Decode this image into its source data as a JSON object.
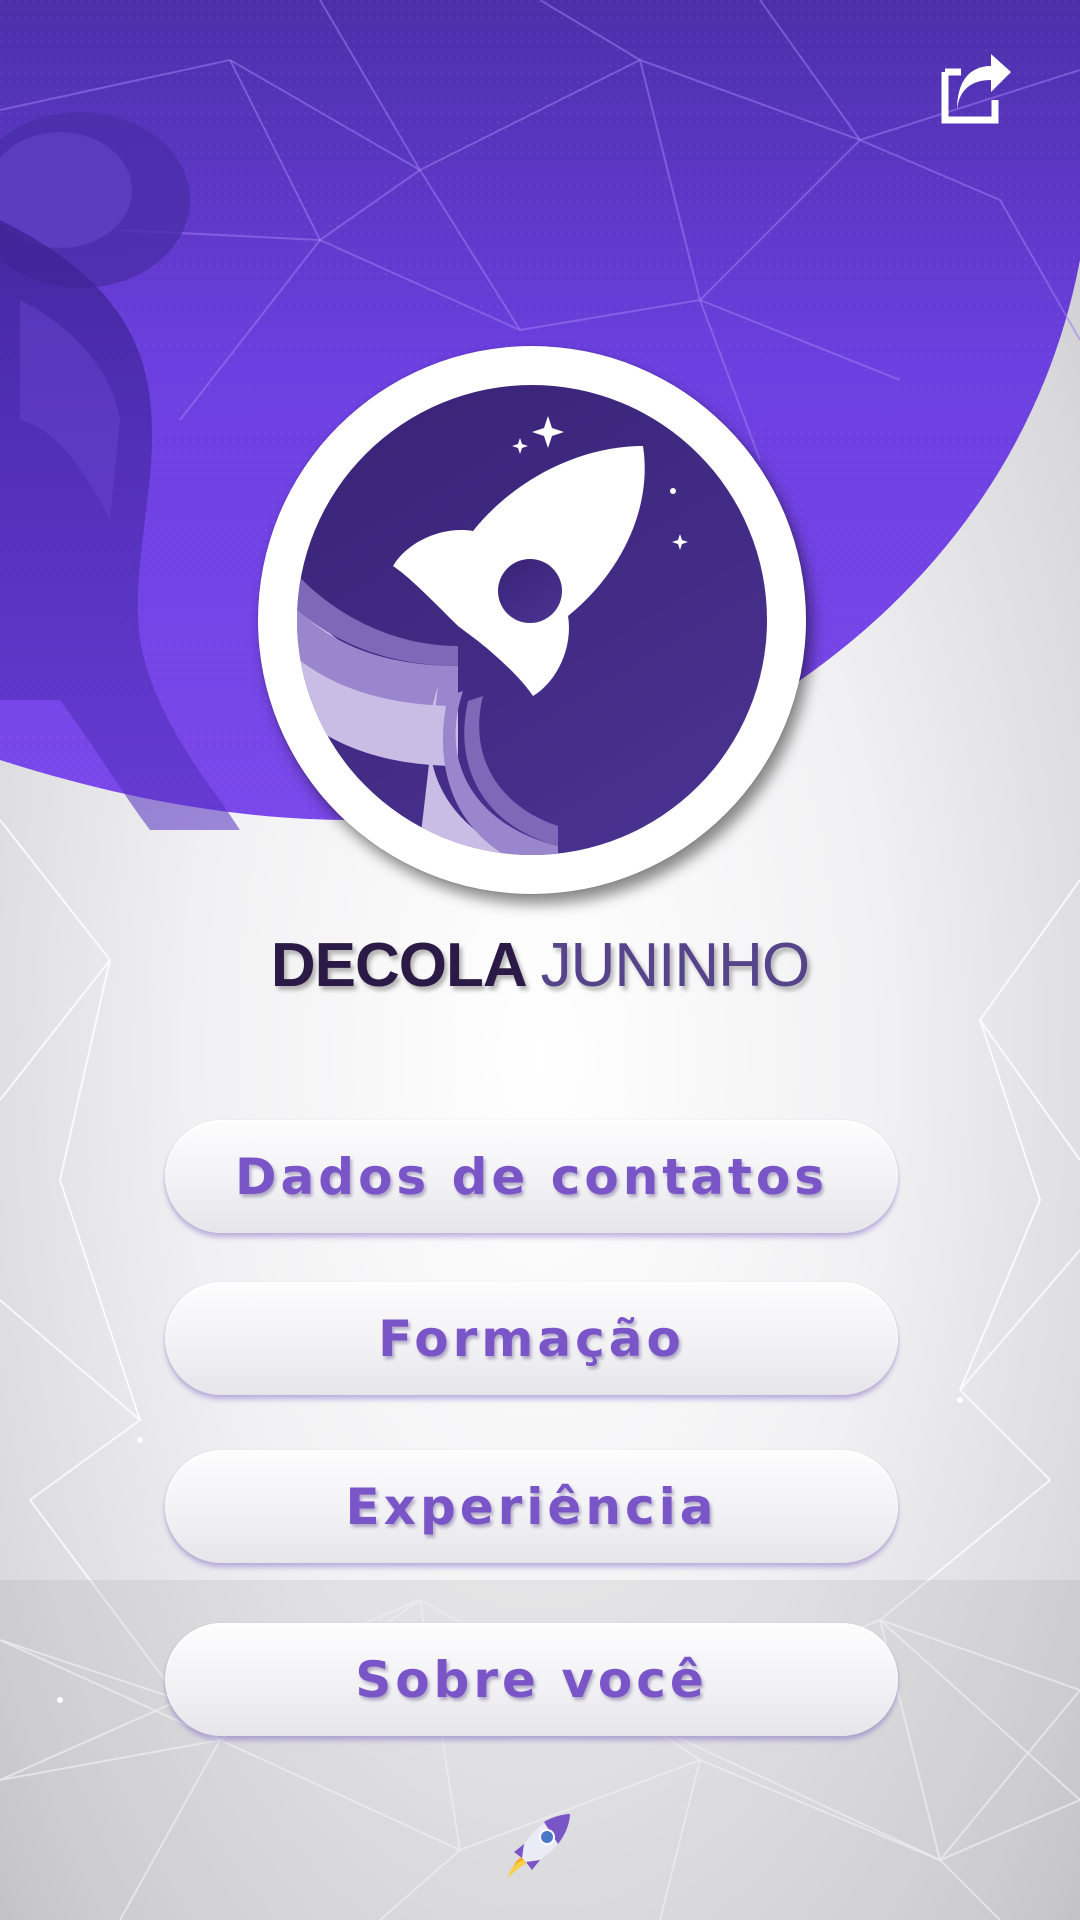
{
  "app": {
    "title_part1": "DECOLA",
    "title_part2": "JUNINHO"
  },
  "header": {
    "share_icon": "share-icon"
  },
  "logo": {
    "icon": "rocket-icon"
  },
  "menu": {
    "items": [
      {
        "label": "Dados de contatos"
      },
      {
        "label": "Formação"
      },
      {
        "label": "Experiência"
      },
      {
        "label": "Sobre você"
      }
    ]
  },
  "footer": {
    "icon": "rocket-icon"
  },
  "colors": {
    "primary_purple": "#6a3fd6",
    "dark_purple": "#3b2570",
    "button_text": "#7a55c8",
    "title_dark": "#2a1a45",
    "title_light": "#56448a"
  }
}
